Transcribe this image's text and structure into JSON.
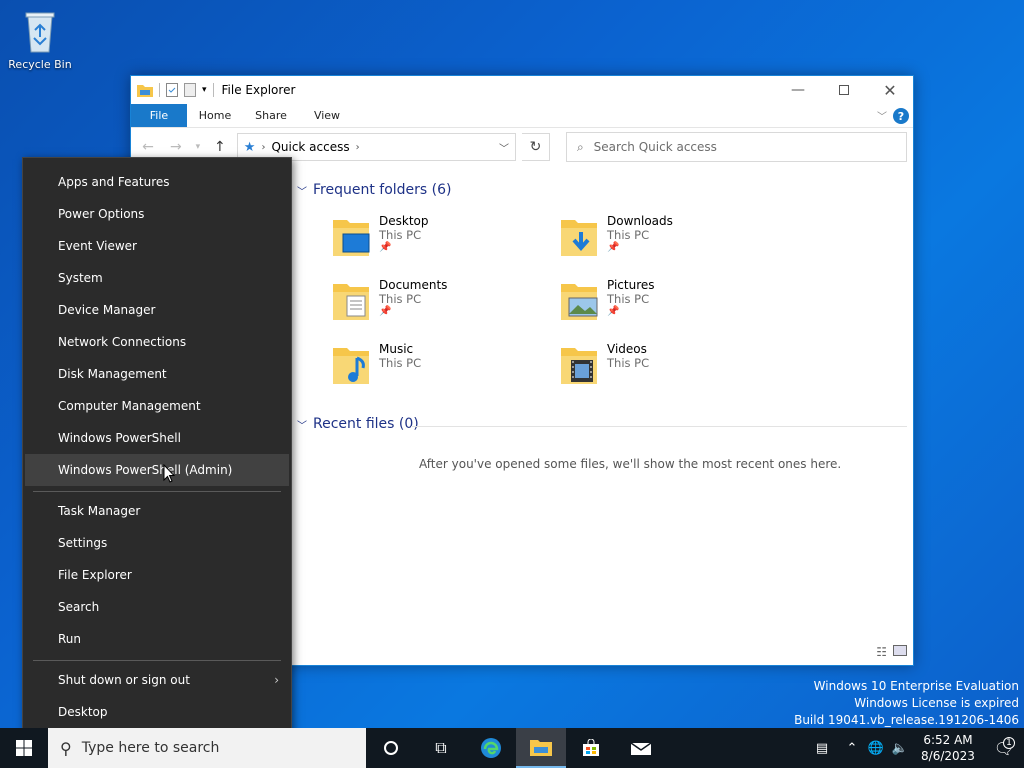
{
  "desktop": {
    "recycle_bin_label": "Recycle Bin"
  },
  "explorer": {
    "title": "File Explorer",
    "tabs": [
      "File",
      "Home",
      "Share",
      "View"
    ],
    "address": "Quick access",
    "search_placeholder": "Search Quick access",
    "frequent_header": "Frequent folders (6)",
    "recent_header": "Recent files (0)",
    "empty_message": "After you've opened some files, we'll show the most recent ones here.",
    "folders": [
      {
        "name": "Desktop",
        "location": "This PC",
        "pinned": true
      },
      {
        "name": "Downloads",
        "location": "This PC",
        "pinned": true
      },
      {
        "name": "Documents",
        "location": "This PC",
        "pinned": true
      },
      {
        "name": "Pictures",
        "location": "This PC",
        "pinned": true
      },
      {
        "name": "Music",
        "location": "This PC",
        "pinned": false
      },
      {
        "name": "Videos",
        "location": "This PC",
        "pinned": false
      }
    ]
  },
  "context_menu": {
    "items": [
      "Apps and Features",
      "Power Options",
      "Event Viewer",
      "System",
      "Device Manager",
      "Network Connections",
      "Disk Management",
      "Computer Management",
      "Windows PowerShell",
      "Windows PowerShell (Admin)",
      "Task Manager",
      "Settings",
      "File Explorer",
      "Search",
      "Run",
      "Shut down or sign out",
      "Desktop"
    ],
    "highlighted": "Windows PowerShell (Admin)"
  },
  "watermark": {
    "line1": "Windows 10 Enterprise Evaluation",
    "line2": "Windows License is expired",
    "line3": "Build 19041.vb_release.191206-1406"
  },
  "taskbar": {
    "search_placeholder": "Type here to search",
    "time": "6:52 AM",
    "date": "8/6/2023",
    "notification_count": "1"
  },
  "colors": {
    "accent": "#1979ca",
    "menu_bg": "#2b2b2b",
    "taskbar_bg": "#101820"
  }
}
